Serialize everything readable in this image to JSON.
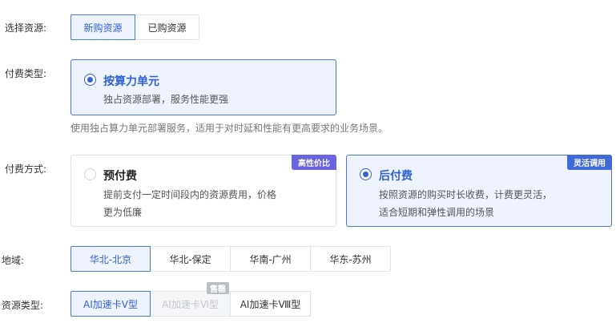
{
  "resource_select": {
    "label": "选择资源:",
    "options": [
      "新购资源",
      "已购资源"
    ],
    "selected": 0
  },
  "billing_type": {
    "label": "付费类型:",
    "card": {
      "title": "按算力单元",
      "desc": "独占资源部署，服务性能更强"
    },
    "hint": "使用独占算力单元部署服务，适用于对时延和性能有更高要求的业务场景。"
  },
  "payment_method": {
    "label": "付费方式:",
    "prepaid": {
      "title": "预付费",
      "desc_line1": "提前支付一定时间段内的资源费用，价格",
      "desc_line2": "更为低廉",
      "badge": "高性价比"
    },
    "postpaid": {
      "title": "后付费",
      "desc_line1": "按照资源的购买时长收费，计费更灵活，",
      "desc_line2": "适合短期和弹性调用的场景",
      "badge": "灵活调用"
    }
  },
  "region": {
    "label": "地域:",
    "options": [
      "华北-北京",
      "华北-保定",
      "华南-广州",
      "华东-苏州"
    ],
    "selected": 0
  },
  "resource_type": {
    "label": "资源类型:",
    "options": [
      "AI加速卡Ⅴ型",
      "AI加速卡Ⅵ型",
      "AI加速卡Ⅷ型"
    ],
    "selected": 0,
    "soldout_badge": "售罄"
  },
  "colors": {
    "accent": "#2f62d6",
    "selected_bg": "#eef3fd",
    "badge_purple": "#6b63e0",
    "badge_blue": "#3f6ad8"
  }
}
